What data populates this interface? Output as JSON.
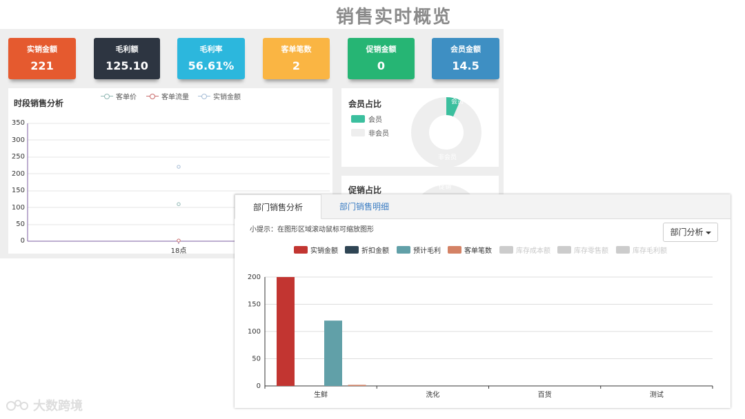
{
  "page": {
    "title": "销售实时概览"
  },
  "kpis": [
    {
      "label": "实销金额",
      "value": "221",
      "color": "#e55a2f"
    },
    {
      "label": "毛利额",
      "value": "125.10",
      "color": "#2d3541"
    },
    {
      "label": "毛利率",
      "value": "56.61%",
      "color": "#2cb7dd"
    },
    {
      "label": "客单笔数",
      "value": "2",
      "color": "#fab543"
    },
    {
      "label": "促销金额",
      "value": "0",
      "color": "#26b574"
    },
    {
      "label": "会员金额",
      "value": "14.5",
      "color": "#3e8fc3"
    }
  ],
  "timeChart": {
    "title": "时段销售分析",
    "legend": [
      "客单价",
      "客单流量",
      "实销金额"
    ],
    "legend_colors": [
      "#8fb7b3",
      "#c96b6b",
      "#a5bcd6"
    ],
    "yTicks": [
      "350",
      "300",
      "250",
      "200",
      "150",
      "100",
      "50",
      "0"
    ],
    "xTicks": [
      "18点"
    ]
  },
  "member": {
    "title": "会员占比",
    "legend": [
      "会员",
      "非会员"
    ],
    "colors": [
      "#3bbf9e",
      "#eeeeee"
    ],
    "slice_labels": [
      "会员",
      "非会员"
    ],
    "member_fraction": 0.066
  },
  "promo": {
    "title": "促销占比",
    "slice_label": "促销"
  },
  "dept": {
    "tabs": [
      "部门销售分析",
      "部门销售明细"
    ],
    "hint": "小提示：在图形区域滚动鼠标可缩放图形",
    "dropdown": "部门分析",
    "legend": [
      {
        "name": "实销金额",
        "color": "#c23531",
        "active": true
      },
      {
        "name": "折扣金额",
        "color": "#2f4554",
        "active": true
      },
      {
        "name": "预计毛利",
        "color": "#61a0a8",
        "active": true
      },
      {
        "name": "客单笔数",
        "color": "#d48265",
        "active": true
      },
      {
        "name": "库存成本额",
        "color": "#cccccc",
        "active": false
      },
      {
        "name": "库存零售额",
        "color": "#cccccc",
        "active": false
      },
      {
        "name": "库存毛利额",
        "color": "#cccccc",
        "active": false
      }
    ]
  },
  "chart_data": [
    {
      "type": "line",
      "title": "时段销售分析",
      "categories": [
        "18点"
      ],
      "ylim": [
        0,
        350
      ],
      "series": [
        {
          "name": "客单价",
          "values": [
            110
          ]
        },
        {
          "name": "客单流量",
          "values": [
            2
          ]
        },
        {
          "name": "实销金额",
          "values": [
            221
          ]
        }
      ],
      "grid": true,
      "legend_position": "top"
    },
    {
      "type": "pie",
      "title": "会员占比",
      "categories": [
        "会员",
        "非会员"
      ],
      "values": [
        14.5,
        206.5
      ],
      "legend_position": "left"
    },
    {
      "type": "bar",
      "categories": [
        "生鲜",
        "洗化",
        "百货",
        "测试"
      ],
      "ylim": [
        0,
        200
      ],
      "yticks": [
        "200",
        "150",
        "100",
        "50",
        "0"
      ],
      "series": [
        {
          "name": "实销金额",
          "values": [
            221,
            0,
            0,
            0
          ]
        },
        {
          "name": "折扣金额",
          "values": [
            0,
            0,
            0,
            0
          ]
        },
        {
          "name": "预计毛利",
          "values": [
            120,
            0,
            0,
            0
          ]
        },
        {
          "name": "客单笔数",
          "values": [
            2,
            0,
            0,
            0
          ]
        }
      ],
      "grid": true,
      "legend_position": "top"
    }
  ],
  "watermark": "大数跨境"
}
